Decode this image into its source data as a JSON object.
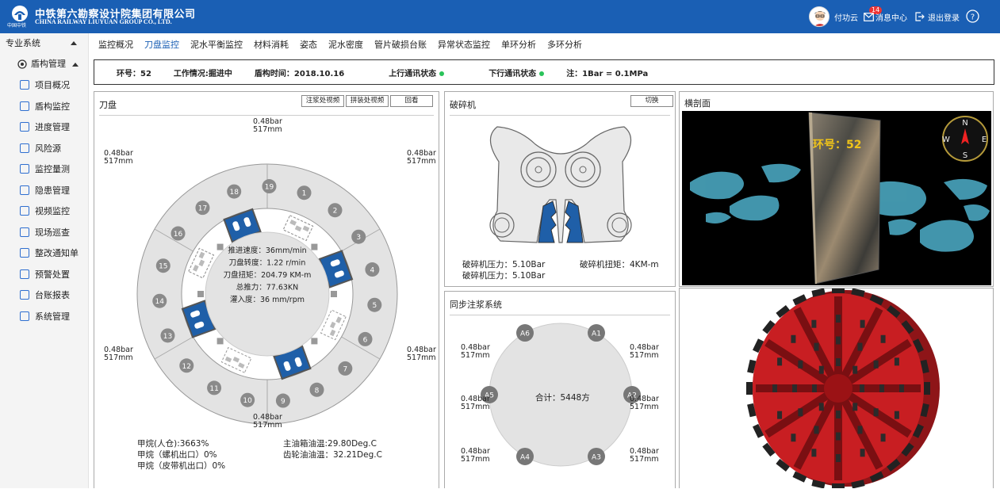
{
  "header": {
    "logo_sub": "中国中铁",
    "brand_cn": "中铁第六勘察设计院集团有限公司",
    "brand_en": "CHINA RAILWAY LIUYUAN GROUP CO., LTD.",
    "user_name": "付功云",
    "msg_badge": "14",
    "msg_label": "消息中心",
    "logout_label": "退出登录"
  },
  "sidebar": {
    "section": "专业系统",
    "group": "盾构管理",
    "items": [
      {
        "label": "项目概况",
        "icon": "project-icon"
      },
      {
        "label": "盾构监控",
        "icon": "fan-icon"
      },
      {
        "label": "进度管理",
        "icon": "progress-icon"
      },
      {
        "label": "风险源",
        "icon": "risk-icon"
      },
      {
        "label": "监控量测",
        "icon": "measure-icon"
      },
      {
        "label": "隐患管理",
        "icon": "hazard-icon"
      },
      {
        "label": "视频监控",
        "icon": "video-icon"
      },
      {
        "label": "现场巡查",
        "icon": "patrol-icon"
      },
      {
        "label": "整改通知单",
        "icon": "notice-icon"
      },
      {
        "label": "预警处置",
        "icon": "warning-icon"
      },
      {
        "label": "台账报表",
        "icon": "report-icon"
      },
      {
        "label": "系统管理",
        "icon": "settings-icon"
      }
    ]
  },
  "nav": {
    "tabs": [
      "监控概况",
      "刀盘监控",
      "泥水平衡监控",
      "材料消耗",
      "姿态",
      "泥水密度",
      "管片破损台账",
      "异常状态监控",
      "单环分析",
      "多环分析"
    ],
    "active": "刀盘监控"
  },
  "status": {
    "ring": "环号：52",
    "work": "工作情况:掘进中",
    "time": "盾构时间：2018.10.16",
    "up": "上行通讯状态",
    "down": "下行通讯状态",
    "note": "注：1Bar = 0.1MPa"
  },
  "cutterhead": {
    "title": "刀盘",
    "btn_front": "注浆处视频",
    "btn_side": "拼装处视频",
    "btn_back": "回看",
    "pressure_labels": [
      {
        "bar": "0.48bar",
        "mm": "517mm"
      },
      {
        "bar": "0.48bar",
        "mm": "517mm"
      },
      {
        "bar": "0.48bar",
        "mm": "517mm"
      },
      {
        "bar": "0.48bar",
        "mm": "517mm"
      },
      {
        "bar": "0.48bar",
        "mm": "517mm"
      },
      {
        "bar": "0.48bar",
        "mm": "517mm"
      }
    ],
    "center": [
      "推进速度：36mm/min",
      "刀盘转度：1.22 r/min",
      "刀盘扭矩：204.79 KM-m",
      "总推力：77.63KN",
      "灌入度：36 mm/rpm"
    ],
    "numbers": [
      "1",
      "2",
      "3",
      "4",
      "5",
      "6",
      "7",
      "8",
      "9",
      "10",
      "11",
      "12",
      "13",
      "14",
      "15",
      "16",
      "17",
      "18",
      "19"
    ],
    "bottom_left": [
      "甲烷(人仓):3663%",
      "甲烷（螺机出口）0%",
      "甲烷（皮带机出口）0%"
    ],
    "bottom_right": [
      "主油箱油温:29.80Deg.C",
      "齿轮油油温：32.21Deg.C"
    ]
  },
  "crusher": {
    "title": "破碎机",
    "btn": "切换",
    "line1a": "破碎机压力：5.10Bar",
    "line1b": "破碎机扭矩：4KM-m",
    "line2": "破碎机压力：5.10Bar"
  },
  "grouting": {
    "title": "同步注浆系统",
    "total": "合计：5448方",
    "points": [
      "A1",
      "A2",
      "A3",
      "A4",
      "A5",
      "A6"
    ],
    "labels": [
      {
        "bar": "0.48bar",
        "mm": "517mm"
      },
      {
        "bar": "0.48bar",
        "mm": "517mm"
      },
      {
        "bar": "0.48bar",
        "mm": "517mm"
      },
      {
        "bar": "0.48bar",
        "mm": "517mm"
      },
      {
        "bar": "0.48bar",
        "mm": "517mm"
      },
      {
        "bar": "0.48bar",
        "mm": "517mm"
      }
    ]
  },
  "section": {
    "title": "横剖面",
    "ring_label": "环号：52",
    "compass": [
      "N",
      "E",
      "S",
      "W"
    ]
  },
  "colors": {
    "header_bg": "#1a5fb4",
    "accent_blue": "#1f5fa8",
    "status_green": "#2ac35a",
    "shield_red": "#c81e22"
  }
}
